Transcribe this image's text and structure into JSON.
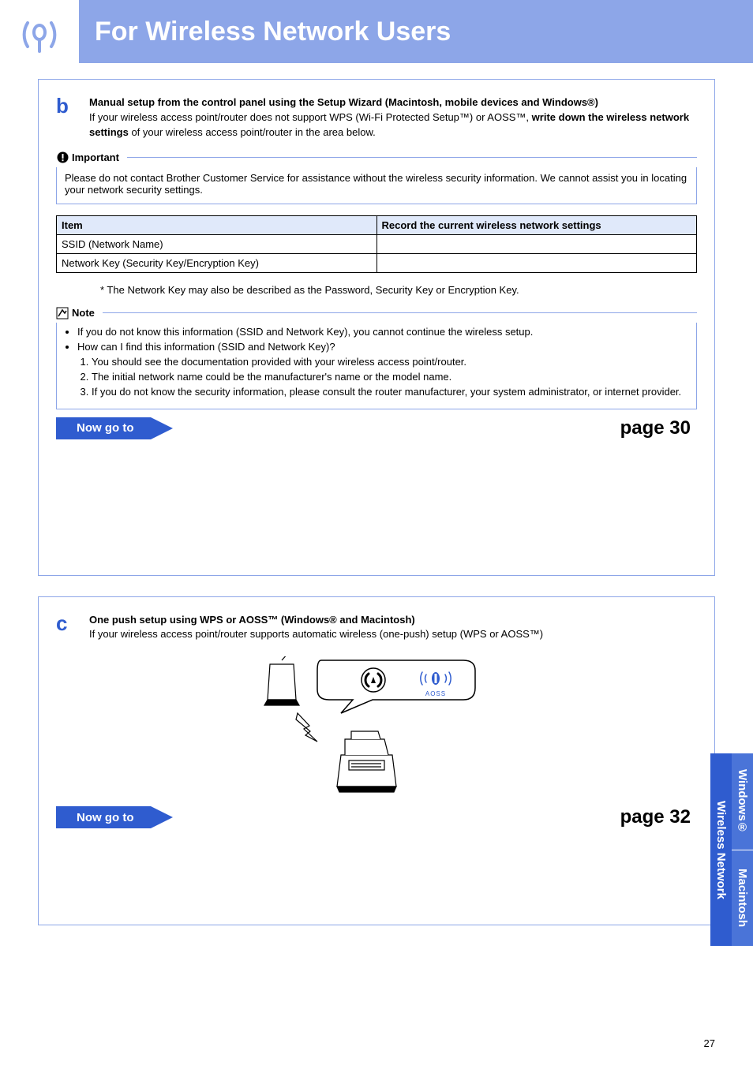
{
  "header": {
    "title": "For Wireless Network Users"
  },
  "sectionB": {
    "letter": "b",
    "title": "Manual setup from the control panel using the Setup Wizard (Macintosh, mobile devices and Windows®)",
    "intro_pre": "If your wireless access point/router does not support WPS (Wi-Fi Protected Setup™) or AOSS™, ",
    "intro_bold": "write down the wireless network settings",
    "intro_post": " of your wireless access point/router in the area below.",
    "important_label": "Important",
    "important_text": "Please do not contact Brother Customer Service for assistance without the wireless security information. We cannot assist you in locating your network security settings.",
    "table": {
      "head1": "Item",
      "head2": "Record the current wireless network settings",
      "row1": "SSID (Network Name)",
      "row2": "Network Key (Security Key/Encryption Key)"
    },
    "asterisk": "*   The Network Key may also be described as the Password, Security Key or Encryption Key.",
    "note_label": "Note",
    "note_bullets": [
      "If you do not know this information (SSID and Network Key), you cannot continue the wireless setup.",
      "How can I find this information (SSID and Network Key)?"
    ],
    "note_ol": [
      "You should see the documentation provided with your wireless access point/router.",
      "The initial network name could be the manufacturer's name or the model name.",
      "If you do not know the security information, please consult the router manufacturer, your system administrator, or internet provider."
    ],
    "goto_label": "Now go to",
    "goto_page": "page 30"
  },
  "sectionC": {
    "letter": "c",
    "title": "One push setup using WPS or AOSS™ (Windows® and Macintosh)",
    "intro": "If your wireless access point/router supports automatic wireless (one-push) setup (WPS or AOSS™)",
    "aoss_label": "AOSS",
    "goto_label": "Now go to",
    "goto_page": "page 32"
  },
  "tabs": {
    "wireless": "Wireless Network",
    "windows": "Windows®",
    "mac": "Macintosh"
  },
  "page_number": "27"
}
